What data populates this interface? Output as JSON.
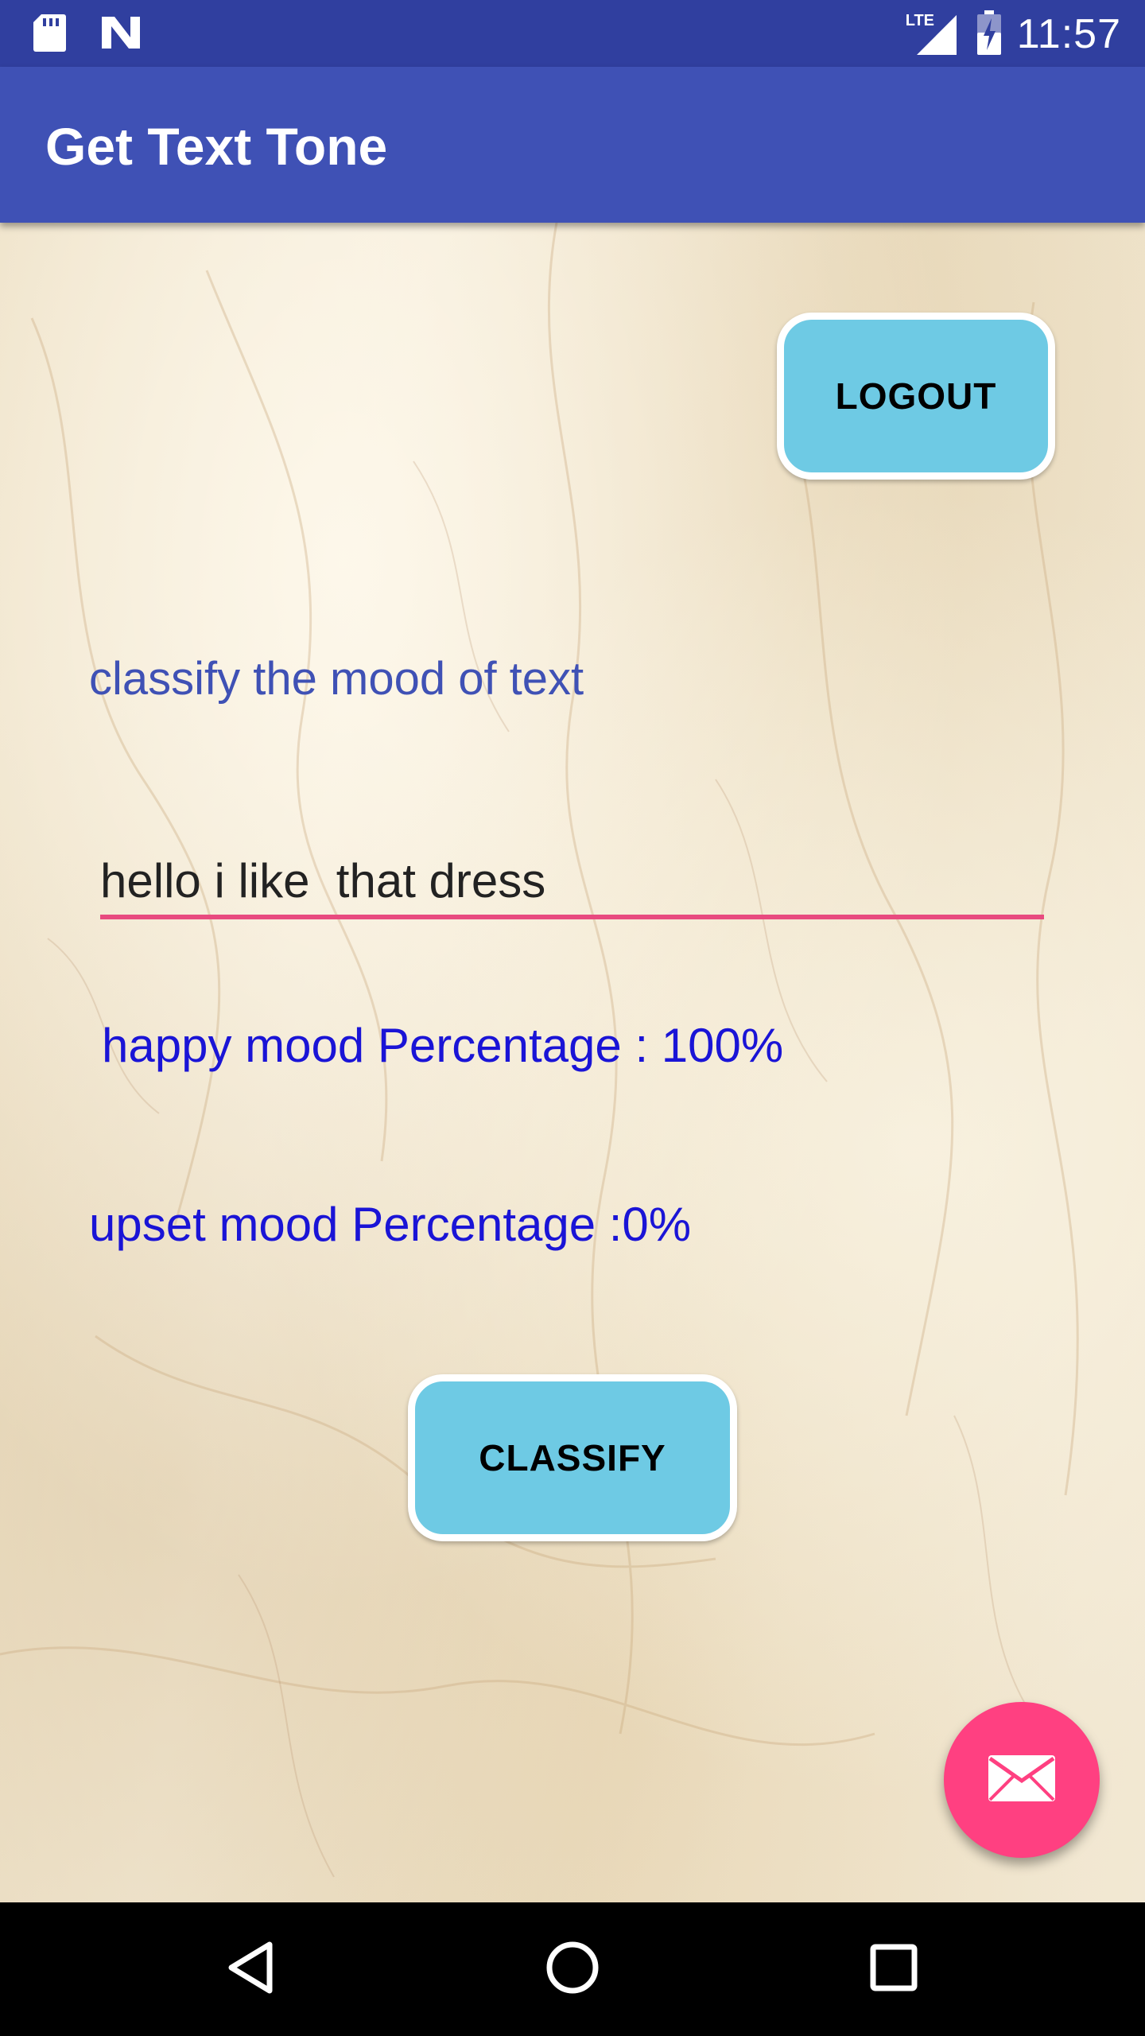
{
  "status_bar": {
    "time": "11:57",
    "network_type": "LTE",
    "icons": [
      "sd-card-icon",
      "n-notification-icon",
      "lte-signal-icon",
      "battery-charging-icon"
    ]
  },
  "app_bar": {
    "title": "Get Text Tone"
  },
  "main": {
    "logout_label": "LOGOUT",
    "prompt": "classify the mood of text",
    "input_value": "hello i like  that dress",
    "happy_text": "happy mood Percentage : 100%",
    "upset_text": "upset mood Percentage :0%",
    "classify_label": "CLASSIFY",
    "fab_icon": "mail-icon"
  },
  "nav_bar": {
    "icons": [
      "back-icon",
      "home-icon",
      "recents-icon"
    ]
  },
  "colors": {
    "status_bar": "#303f9f",
    "app_bar": "#3f51b5",
    "button_fill": "#6ecae4",
    "input_underline": "#e84a7f",
    "result_text": "#1a14d6",
    "fab": "#ff4081"
  }
}
